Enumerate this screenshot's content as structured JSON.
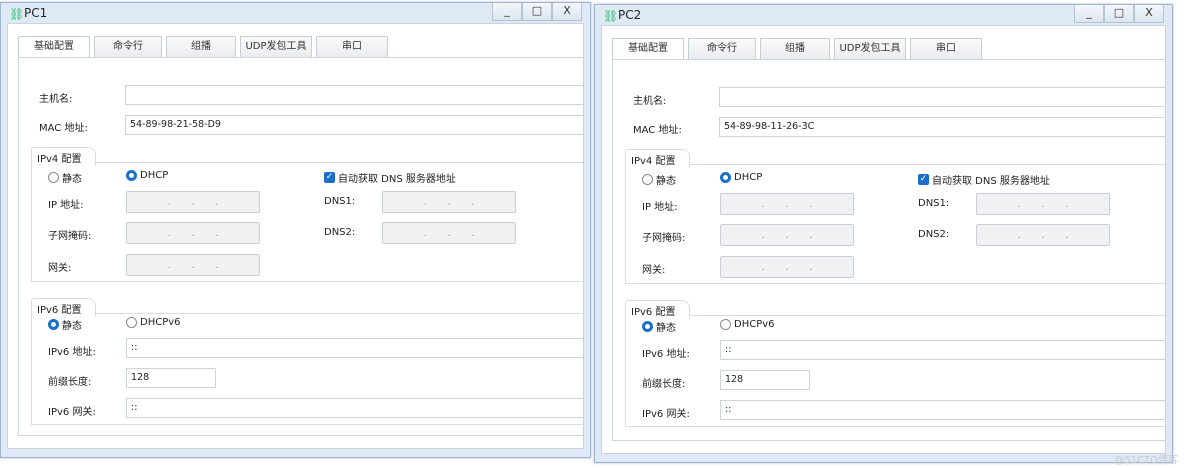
{
  "tabs": [
    "基础配置",
    "命令行",
    "组播",
    "UDP发包工具",
    "串口"
  ],
  "controls": {
    "minimize": "_",
    "maximize": "□",
    "close": "X"
  },
  "labels": {
    "hostname": "主机名:",
    "mac": "MAC 地址:",
    "ipv4_group": "IPv4 配置",
    "static": "静态",
    "dhcp": "DHCP",
    "auto_dns": "自动获取 DNS 服务器地址",
    "ip": "IP 地址:",
    "mask": "子网掩码:",
    "gateway": "网关:",
    "dns1": "DNS1:",
    "dns2": "DNS2:",
    "ipv6_group": "IPv6 配置",
    "dhcpv6": "DHCPv6",
    "ipv6_addr": "IPv6 地址:",
    "prefix": "前缀长度:",
    "ipv6_gw": "IPv6 网关:"
  },
  "pc1": {
    "title": "PC1",
    "hostname": "",
    "mac": "54-89-98-21-58-D9",
    "ipv6_addr": "::",
    "prefix": "128",
    "ipv6_gw": "::"
  },
  "pc2": {
    "title": "PC2",
    "hostname": "",
    "mac": "54-89-98-11-26-3C",
    "ipv6_addr": "::",
    "prefix": "128",
    "ipv6_gw": "::"
  },
  "ip_placeholder": ".",
  "watermark": "@51CTO博客"
}
